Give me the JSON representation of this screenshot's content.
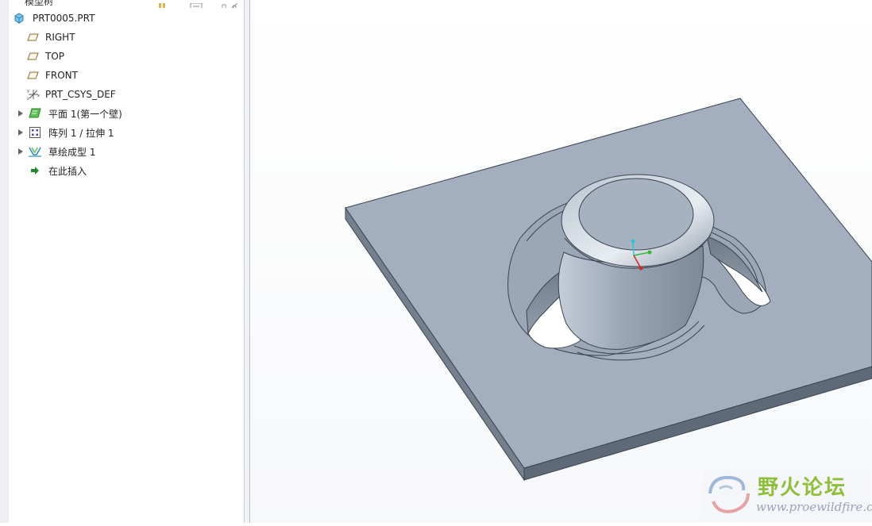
{
  "panel": {
    "title": "模型树"
  },
  "tree": {
    "items": [
      {
        "label": "PRT0005.PRT",
        "icon": "part-cube-icon",
        "expandable": false
      },
      {
        "label": "RIGHT",
        "icon": "datum-plane-icon",
        "expandable": false
      },
      {
        "label": "TOP",
        "icon": "datum-plane-icon",
        "expandable": false
      },
      {
        "label": "FRONT",
        "icon": "datum-plane-icon",
        "expandable": false
      },
      {
        "label": "PRT_CSYS_DEF",
        "icon": "csys-icon",
        "expandable": false
      },
      {
        "label": "平面 1(第一个壁)",
        "icon": "flat-wall-icon",
        "expandable": true
      },
      {
        "label": "阵列 1 / 拉伸 1",
        "icon": "pattern-icon",
        "expandable": true
      },
      {
        "label": "草绘成型 1",
        "icon": "sketched-form-icon",
        "expandable": true
      },
      {
        "label": "在此插入",
        "icon": "insert-here-arrow-icon",
        "expandable": false
      }
    ]
  },
  "watermark": {
    "name": "野火论坛",
    "url": "www.proewildfire.cn"
  },
  "colors": {
    "model_face": "#a3afbe",
    "model_edge": "#3b4450",
    "insert_arrow": "#1f8a2a",
    "watermark_green": "#8fbf3a"
  }
}
